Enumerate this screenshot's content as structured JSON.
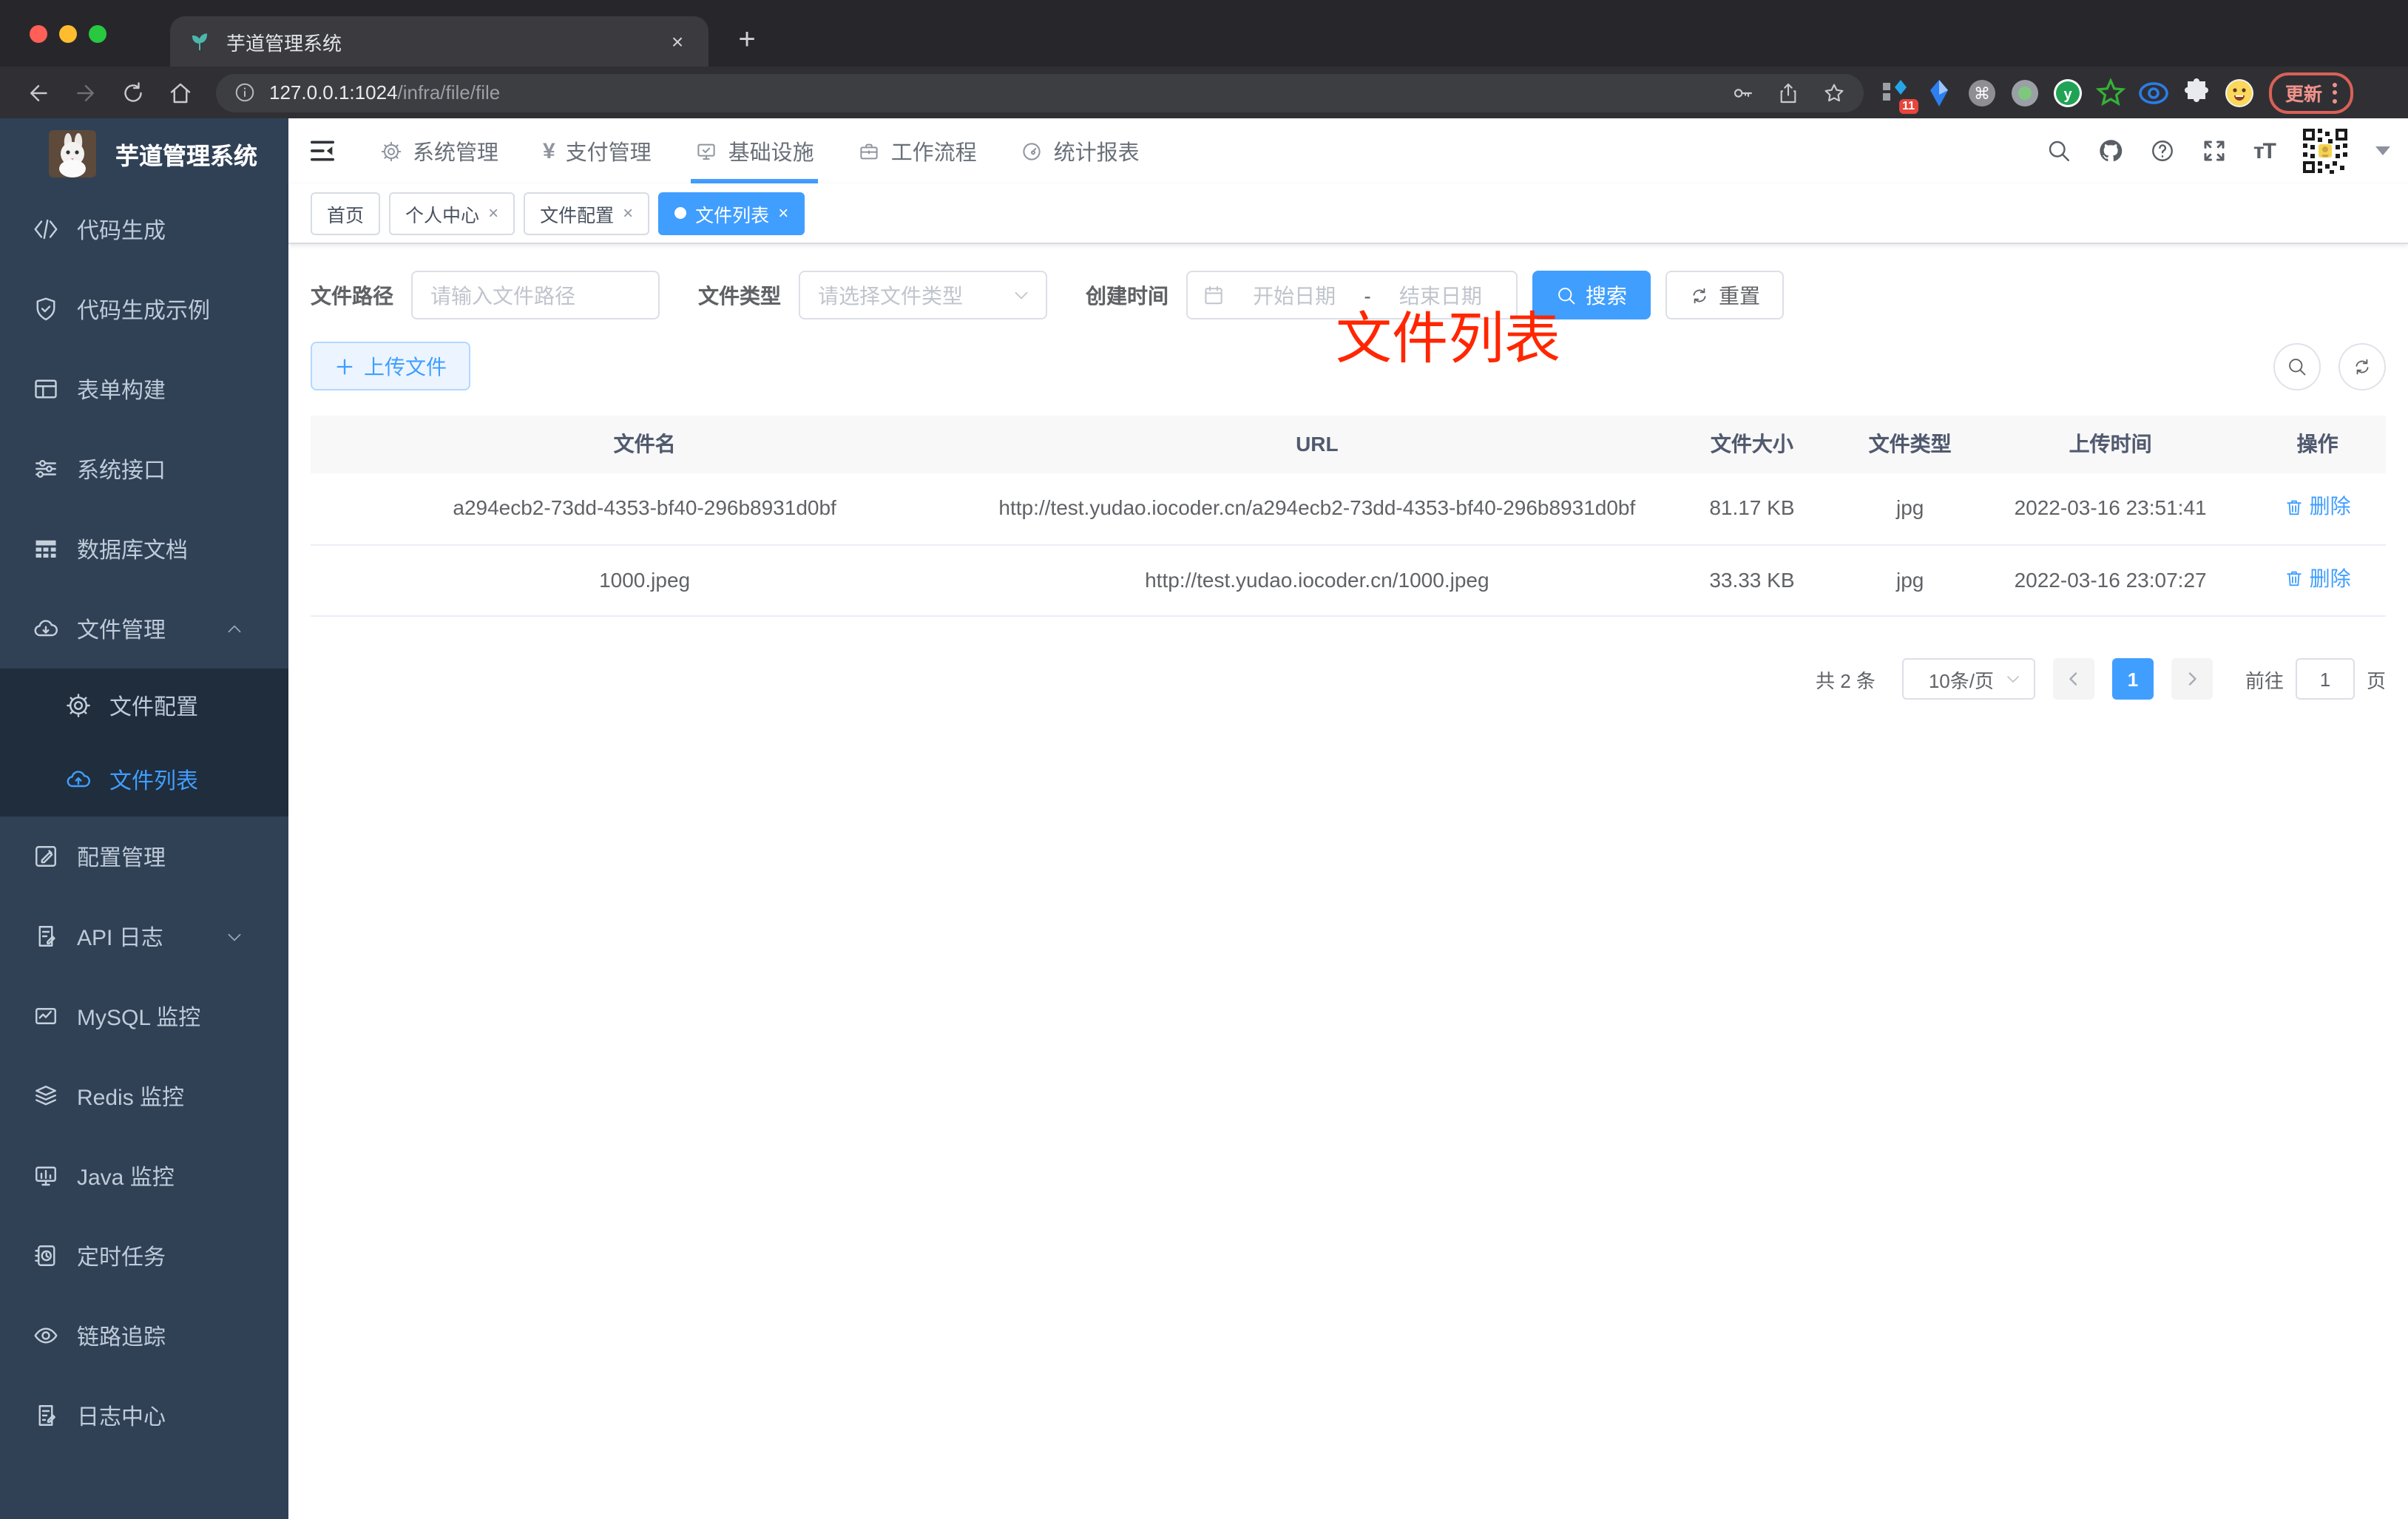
{
  "colors": {
    "primary": "#409EFF",
    "sidebar_bg": "#304156",
    "submenu_bg": "#1f2d3d",
    "annotation_red": "#ff2600",
    "update_button": "#ef928a"
  },
  "browser": {
    "tab_title": "芋道管理系统",
    "new_tab_glyph": "+",
    "close_glyph": "×",
    "url_host": "127.0.0.1:1024",
    "url_path": "/infra/file/file",
    "update_label": "更新",
    "extension_badge": "11",
    "extensions": [
      {
        "icon": "grid-diamond-ext-icon",
        "badge": "11"
      },
      {
        "icon": "blue-kite-ext-icon"
      },
      {
        "icon": "command-ext-icon"
      },
      {
        "icon": "green-dot-ext-icon"
      },
      {
        "icon": "y-circle-ext-icon"
      },
      {
        "icon": "green-star-ext-icon"
      },
      {
        "icon": "blue-eye-ext-icon"
      },
      {
        "icon": "puzzle-ext-icon"
      },
      {
        "icon": "smiley-avatar-icon"
      }
    ]
  },
  "app": {
    "logo_title": "芋道管理系统",
    "nav": [
      {
        "label": "系统管理",
        "icon": "gear"
      },
      {
        "label": "支付管理",
        "icon": "yen"
      },
      {
        "label": "基础设施",
        "icon": "monitor",
        "active": true
      },
      {
        "label": "工作流程",
        "icon": "briefcase"
      },
      {
        "label": "统计报表",
        "icon": "dashboard"
      }
    ],
    "tabs": [
      {
        "label": "首页"
      },
      {
        "label": "个人中心",
        "closable": true
      },
      {
        "label": "文件配置",
        "closable": true
      },
      {
        "label": "文件列表",
        "closable": true,
        "active": true
      }
    ],
    "annotation": "文件列表",
    "sidebar_items": [
      {
        "label": "代码生成",
        "icon": "code"
      },
      {
        "label": "代码生成示例",
        "icon": "shield"
      },
      {
        "label": "表单构建",
        "icon": "form"
      },
      {
        "label": "系统接口",
        "icon": "sliders"
      },
      {
        "label": "数据库文档",
        "icon": "dbtable"
      },
      {
        "label": "文件管理",
        "icon": "clouddown",
        "chevron": "up"
      },
      {
        "label": "文件配置",
        "icon": "gear",
        "sub": true
      },
      {
        "label": "文件列表",
        "icon": "cloudup",
        "sub": true,
        "active": true
      },
      {
        "label": "配置管理",
        "icon": "editsq"
      },
      {
        "label": "API 日志",
        "icon": "docedit",
        "chevron": "down"
      },
      {
        "label": "MySQL 监控",
        "icon": "chartmon"
      },
      {
        "label": "Redis 监控",
        "icon": "layers"
      },
      {
        "label": "Java 监控",
        "icon": "javamon"
      },
      {
        "label": "定时任务",
        "icon": "taskclock"
      },
      {
        "label": "链路追踪",
        "icon": "eye"
      },
      {
        "label": "日志中心",
        "icon": "logedit"
      }
    ],
    "filters": {
      "path_label": "文件路径",
      "path_placeholder": "请输入文件路径",
      "type_label": "文件类型",
      "type_placeholder": "请选择文件类型",
      "time_label": "创建时间",
      "start_placeholder": "开始日期",
      "range_separator": "-",
      "end_placeholder": "结束日期",
      "search_label": "搜索",
      "reset_label": "重置"
    },
    "upload_label": "上传文件",
    "table": {
      "headers": [
        "文件名",
        "URL",
        "文件大小",
        "文件类型",
        "上传时间",
        "操作"
      ],
      "rows": [
        {
          "name": "a294ecb2-73dd-4353-bf40-296b8931d0bf",
          "url": "http://test.yudao.iocoder.cn/a294ecb2-73dd-4353-bf40-296b8931d0bf",
          "size": "81.17 KB",
          "type": "jpg",
          "time": "2022-03-16 23:51:41",
          "action": "删除"
        },
        {
          "name": "1000.jpeg",
          "url": "http://test.yudao.iocoder.cn/1000.jpeg",
          "size": "33.33 KB",
          "type": "jpg",
          "time": "2022-03-16 23:07:27",
          "action": "删除"
        }
      ]
    },
    "pagination": {
      "total": "共 2 条",
      "page_size": "10条/页",
      "current_page": "1",
      "goto_label": "前往",
      "goto_value": "1",
      "page_suffix": "页"
    }
  }
}
